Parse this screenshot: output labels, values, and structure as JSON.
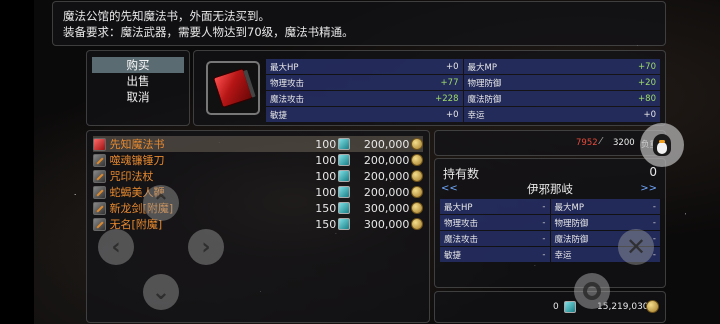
{
  "description": {
    "line1": "魔法公馆的先知魔法书，外面无法买到。",
    "line2": "装备要求：魔法武器，需要人物达到70级，魔法书精通。"
  },
  "menu": {
    "buy": "购买",
    "sell": "出售",
    "cancel": "取消"
  },
  "item_stats": [
    {
      "label": "最大HP",
      "value": "+0"
    },
    {
      "label": "最大MP",
      "value": "+70"
    },
    {
      "label": "物理攻击",
      "value": "+77"
    },
    {
      "label": "物理防御",
      "value": "+20"
    },
    {
      "label": "魔法攻击",
      "value": "+228"
    },
    {
      "label": "魔法防御",
      "value": "+80"
    },
    {
      "label": "敏捷",
      "value": "+0"
    },
    {
      "label": "幸运",
      "value": "+0"
    }
  ],
  "shop_items": [
    {
      "icon": "spellbook-icon",
      "name": "先知魔法书",
      "gem_price": "100",
      "gold_price": "200,000"
    },
    {
      "icon": "blade-icon",
      "name": "噬魂镰锤刀",
      "gem_price": "100",
      "gold_price": "200,000"
    },
    {
      "icon": "staff-icon",
      "name": "咒印法杖",
      "gem_price": "100",
      "gold_price": "200,000"
    },
    {
      "icon": "blade-icon",
      "name": "蛇蝎美人鞭",
      "gem_price": "100",
      "gold_price": "200,000"
    },
    {
      "icon": "sword-icon",
      "name": "新龙剑[附魔]",
      "gem_price": "150",
      "gold_price": "300,000"
    },
    {
      "icon": "sword-icon",
      "name": "无名[附魔]",
      "gem_price": "150",
      "gold_price": "300,000"
    }
  ],
  "weight": {
    "current": "7952",
    "max": "3200",
    "label": "负重"
  },
  "holding": {
    "title": "持有数",
    "count": "0",
    "prev": "<<",
    "next": ">>",
    "hero": "伊邪那岐",
    "stats": [
      {
        "label": "最大HP",
        "value": "-"
      },
      {
        "label": "最大MP",
        "value": "-"
      },
      {
        "label": "物理攻击",
        "value": "-"
      },
      {
        "label": "物理防御",
        "value": "-"
      },
      {
        "label": "魔法攻击",
        "value": "-"
      },
      {
        "label": "魔法防御",
        "value": "-"
      },
      {
        "label": "敏捷",
        "value": "-"
      },
      {
        "label": "幸运",
        "value": "-"
      }
    ]
  },
  "money": {
    "gems": "0",
    "gold": "15,219,030"
  },
  "colors": {
    "item_name": "#e6892f",
    "stat_bg": "#28326e",
    "stat_bonus": "#9fdc6a",
    "weight_over": "#e74a3c",
    "nav_arrow": "#6fa8ff"
  },
  "controls": {
    "up": "chevron-up-icon",
    "down": "chevron-down-icon",
    "left": "chevron-left-icon",
    "right": "chevron-right-icon",
    "close": "close-icon",
    "target": "target-icon",
    "avatar": "penguin-avatar-icon"
  }
}
